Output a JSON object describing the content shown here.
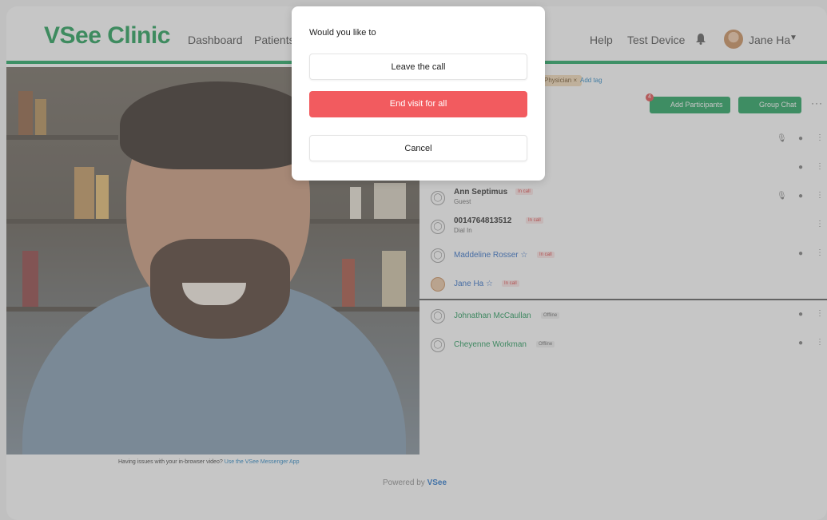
{
  "header": {
    "logo": "VSee Clinic",
    "nav": [
      "Dashboard",
      "Patients"
    ],
    "help": "Help",
    "test_device": "Test Device",
    "user_name": "Jane Ha",
    "accent_color": "#15a35a"
  },
  "video": {
    "note": "Having issues with your in-browser video?",
    "note_link": "Use the VSee Messenger App",
    "controls": [
      "mic-off-icon",
      "camera-off-icon",
      "screen-share-icon",
      "chat-icon",
      "fullscreen-icon",
      "more-icon",
      "end-call-icon"
    ]
  },
  "footer": {
    "powered_by": "Powered by",
    "brand": "VSee"
  },
  "panel": {
    "tag": "Physician",
    "add_tag": "Add tag",
    "add_participants": "Add Participants",
    "participants_count": "4",
    "group_chat": "Group Chat",
    "participants": [
      {
        "name": "Ann Septimus",
        "sub": "Guest",
        "badge": "In call"
      },
      {
        "name": "0014764813512",
        "sub": "Dial In",
        "badge": "In call"
      },
      {
        "name": "Maddeline Rosser ☆",
        "sub": "",
        "badge": "In call"
      },
      {
        "name": "Jane Ha ☆",
        "sub": "",
        "badge": "In call"
      },
      {
        "name": "Johnathan McCaullan",
        "sub": "",
        "badge": "Offline"
      },
      {
        "name": "Cheyenne Workman",
        "sub": "",
        "badge": "Offline"
      }
    ]
  },
  "modal": {
    "question": "Would you like to",
    "leave": "Leave the call",
    "end": "End visit for all",
    "cancel": "Cancel",
    "end_color": "#f25b5f"
  }
}
